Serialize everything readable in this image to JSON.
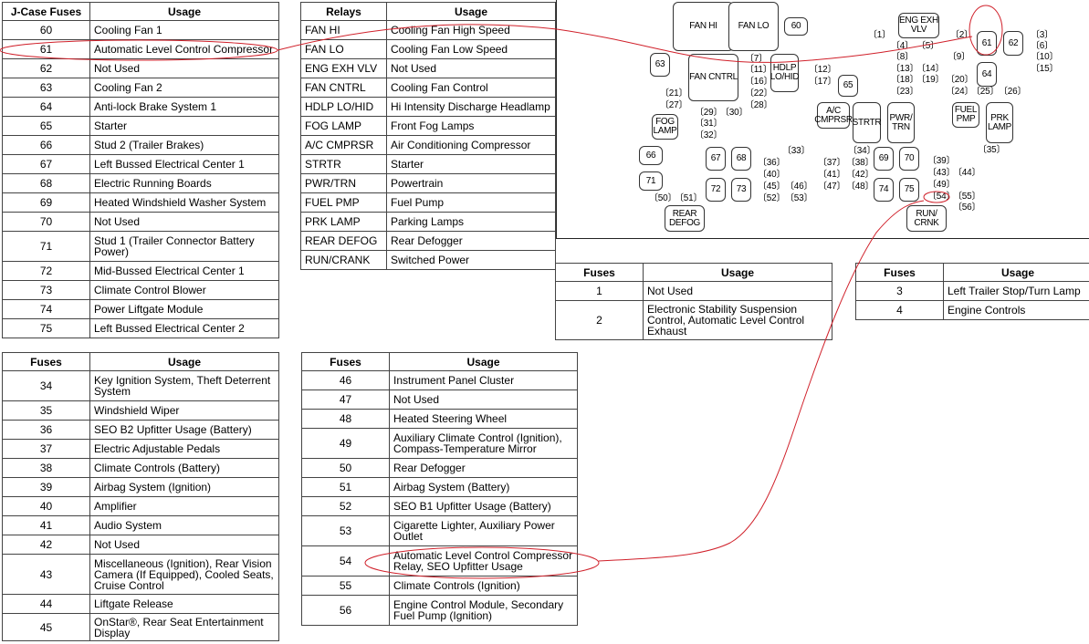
{
  "jcase_table": {
    "headers": [
      "J-Case Fuses",
      "Usage"
    ],
    "rows": [
      [
        "60",
        "Cooling Fan 1"
      ],
      [
        "61",
        "Automatic Level Control Compressor"
      ],
      [
        "62",
        "Not Used"
      ],
      [
        "63",
        "Cooling Fan 2"
      ],
      [
        "64",
        "Anti-lock Brake System 1"
      ],
      [
        "65",
        "Starter"
      ],
      [
        "66",
        "Stud 2 (Trailer Brakes)"
      ],
      [
        "67",
        "Left Bussed Electrical Center 1"
      ],
      [
        "68",
        "Electric Running Boards"
      ],
      [
        "69",
        "Heated Windshield Washer System"
      ],
      [
        "70",
        "Not Used"
      ],
      [
        "71",
        "Stud 1 (Trailer Connector Battery Power)"
      ],
      [
        "72",
        "Mid-Bussed Electrical Center 1"
      ],
      [
        "73",
        "Climate Control Blower"
      ],
      [
        "74",
        "Power Liftgate Module"
      ],
      [
        "75",
        "Left Bussed Electrical Center 2"
      ]
    ]
  },
  "relays_table": {
    "headers": [
      "Relays",
      "Usage"
    ],
    "rows": [
      [
        "FAN HI",
        "Cooling Fan High Speed"
      ],
      [
        "FAN LO",
        "Cooling Fan Low Speed"
      ],
      [
        "ENG EXH VLV",
        "Not Used"
      ],
      [
        "FAN CNTRL",
        "Cooling Fan Control"
      ],
      [
        "HDLP LO/HID",
        "Hi Intensity Discharge Headlamp"
      ],
      [
        "FOG LAMP",
        "Front Fog Lamps"
      ],
      [
        "A/C CMPRSR",
        "Air Conditioning Compressor"
      ],
      [
        "STRTR",
        "Starter"
      ],
      [
        "PWR/TRN",
        "Powertrain"
      ],
      [
        "FUEL PMP",
        "Fuel Pump"
      ],
      [
        "PRK LAMP",
        "Parking Lamps"
      ],
      [
        "REAR DEFOG",
        "Rear Defogger"
      ],
      [
        "RUN/CRANK",
        "Switched Power"
      ]
    ]
  },
  "fuses_1_2_table": {
    "headers": [
      "Fuses",
      "Usage"
    ],
    "rows": [
      [
        "1",
        "Not Used"
      ],
      [
        "2",
        "Electronic Stability Suspension Control, Automatic Level Control Exhaust"
      ]
    ]
  },
  "fuses_3_4_table": {
    "headers": [
      "Fuses",
      "Usage"
    ],
    "rows": [
      [
        "3",
        "Left Trailer Stop/Turn Lamp"
      ],
      [
        "4",
        "Engine Controls"
      ]
    ]
  },
  "fuses_34_45_table": {
    "headers": [
      "Fuses",
      "Usage"
    ],
    "rows": [
      [
        "34",
        "Key Ignition System, Theft Deterrent System"
      ],
      [
        "35",
        "Windshield Wiper"
      ],
      [
        "36",
        "SEO B2 Upfitter Usage (Battery)"
      ],
      [
        "37",
        "Electric Adjustable Pedals"
      ],
      [
        "38",
        "Climate Controls (Battery)"
      ],
      [
        "39",
        "Airbag System (Ignition)"
      ],
      [
        "40",
        "Amplifier"
      ],
      [
        "41",
        "Audio System"
      ],
      [
        "42",
        "Not Used"
      ],
      [
        "43",
        "Miscellaneous (Ignition), Rear Vision Camera (If Equipped), Cooled Seats, Cruise Control"
      ],
      [
        "44",
        "Liftgate Release"
      ],
      [
        "45",
        "OnStar®, Rear Seat Entertainment Display"
      ]
    ]
  },
  "fuses_46_56_table": {
    "headers": [
      "Fuses",
      "Usage"
    ],
    "rows": [
      [
        "46",
        "Instrument Panel Cluster"
      ],
      [
        "47",
        "Not Used"
      ],
      [
        "48",
        "Heated Steering Wheel"
      ],
      [
        "49",
        "Auxiliary Climate Control (Ignition), Compass-Temperature Mirror"
      ],
      [
        "50",
        "Rear Defogger"
      ],
      [
        "51",
        "Airbag System (Battery)"
      ],
      [
        "52",
        "SEO B1 Upfitter Usage (Battery)"
      ],
      [
        "53",
        "Cigarette Lighter, Auxiliary Power Outlet"
      ],
      [
        "54",
        "Automatic Level Control Compressor Relay, SEO Upfitter Usage"
      ],
      [
        "55",
        "Climate Controls (Ignition)"
      ],
      [
        "56",
        "Engine Control Module, Secondary Fuel Pump (Ignition)"
      ]
    ]
  },
  "diagram": {
    "relays": {
      "fan_hi": "FAN HI",
      "fan_lo": "FAN LO",
      "fan_cntrl": "FAN CNTRL",
      "hdlp": "HDLP LO/HID",
      "eng_exh": "ENG EXH VLV",
      "fog_lamp": "FOG LAMP",
      "ac_cmprsr": "A/C CMPRSR",
      "strtr": "STRTR",
      "pwr_trn": "PWR/ TRN",
      "fuel_pmp": "FUEL PMP",
      "prk_lamp": "PRK LAMP",
      "rear_defog": "REAR DEFOG",
      "run_crank": "RUN/ CRNK"
    },
    "jcase": [
      "60",
      "61",
      "62",
      "63",
      "64",
      "65",
      "66",
      "67",
      "68",
      "69",
      "70",
      "71",
      "72",
      "73",
      "74",
      "75"
    ],
    "mini_fuses": [
      "1",
      "2",
      "3",
      "4",
      "5",
      "6",
      "7",
      "8",
      "9",
      "10",
      "11",
      "12",
      "13",
      "14",
      "15",
      "16",
      "17",
      "18",
      "19",
      "20",
      "21",
      "22",
      "23",
      "24",
      "25",
      "26",
      "27",
      "28",
      "29",
      "30",
      "31",
      "32",
      "33",
      "34",
      "35",
      "36",
      "37",
      "38",
      "39",
      "40",
      "41",
      "42",
      "43",
      "44",
      "45",
      "46",
      "47",
      "48",
      "49",
      "50",
      "51",
      "52",
      "53",
      "54",
      "55",
      "56"
    ]
  },
  "annotations": {
    "color": "#d0202a",
    "highlighted": [
      "61",
      "54"
    ]
  }
}
